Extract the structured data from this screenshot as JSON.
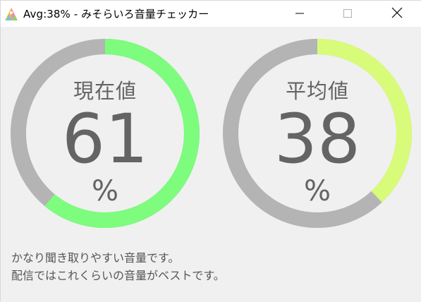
{
  "window": {
    "title": "Avg:38% - みそらいろ音量チェッカー"
  },
  "icons": {
    "app": "app-logo-icon",
    "minimize": "minimize-icon",
    "maximize": "maximize-icon",
    "close": "close-icon"
  },
  "gauges": {
    "current": {
      "title": "現在値",
      "value": "61",
      "unit": "%",
      "percent": 61,
      "color": "#7dfc7d"
    },
    "average": {
      "title": "平均値",
      "value": "38",
      "unit": "%",
      "percent": 38,
      "color": "#d8fc7a"
    },
    "track_color": "#b4b4b4"
  },
  "message": {
    "line1": "かなり聞き取りやすい音量です。",
    "line2": "配信ではこれくらいの音量がベストです。"
  }
}
